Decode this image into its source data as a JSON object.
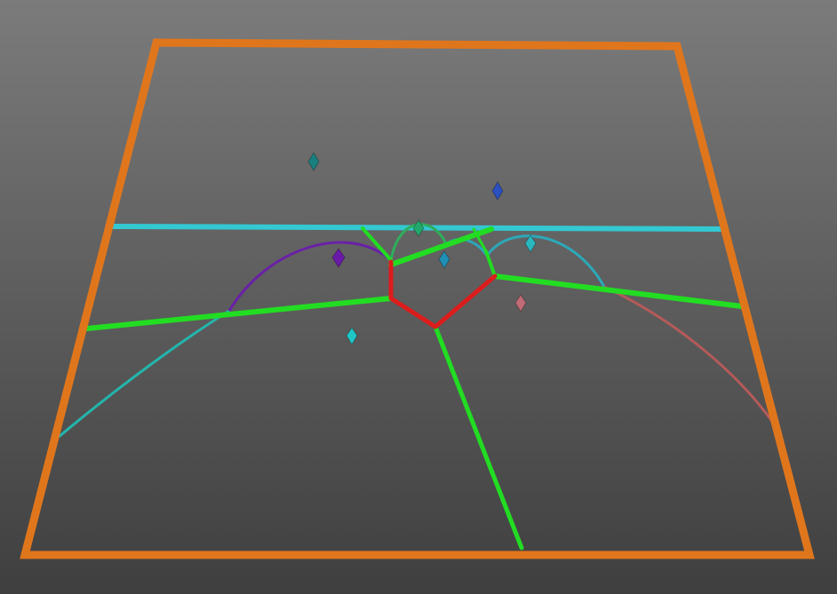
{
  "scene": {
    "kind": "voronoi-fortune-sweepline-3d",
    "colors": {
      "background_top": "#7b7b7b",
      "background_bottom": "#3f3f3f",
      "frame": "#e0761c",
      "sweep_line": "#33c8d2",
      "completed_edge": "#22dd22",
      "finalized_edge": "#dd1c1c",
      "arc_purple": "#6a20a8",
      "arc_teal": "#23b5ac",
      "arc_green": "#2fae5c",
      "arc_cyan": "#2ca8b8",
      "arc_rose": "#b55a5a",
      "site_teal": "#1a7f7f",
      "site_blue": "#2a4fc0",
      "site_purple": "#6a1aa8",
      "site_cyan": "#20c6c6",
      "site_green": "#23a86c",
      "site_skyblue": "#1f8fb5",
      "site_aqua": "#2ab7c0",
      "site_pink": "#c06a75"
    }
  }
}
